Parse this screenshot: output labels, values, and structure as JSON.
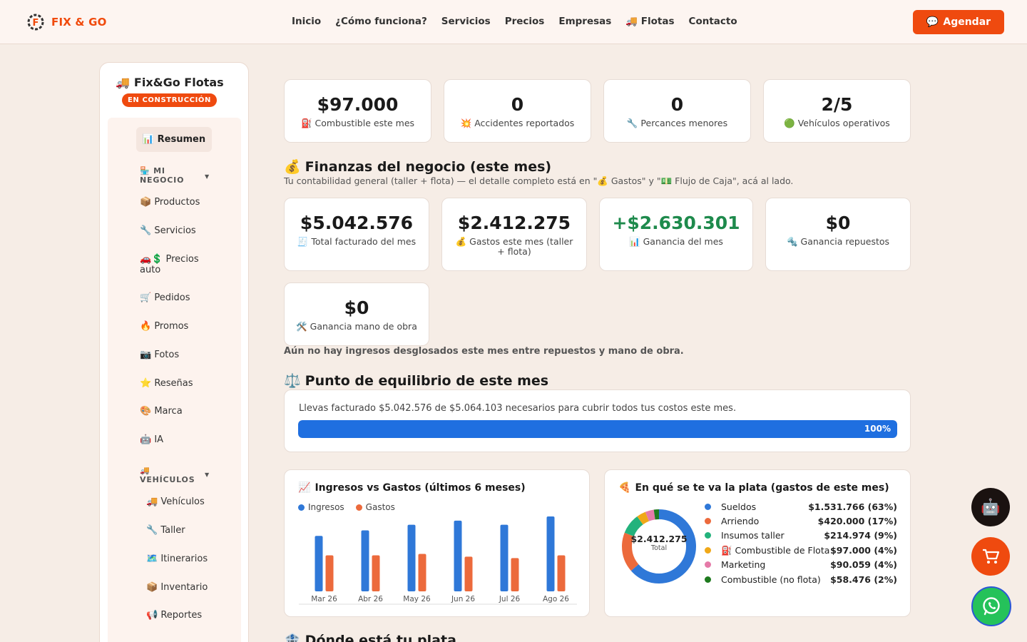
{
  "header": {
    "logo_text": "FIX & GO",
    "nav": [
      "Inicio",
      "¿Cómo funciona?",
      "Servicios",
      "Precios",
      "Empresas",
      "🚚 Flotas",
      "Contacto"
    ],
    "cta_label": "Agendar",
    "cta_icon": "💬"
  },
  "sidebar": {
    "title": "Fix&Go Flotas",
    "title_icon": "🚚",
    "badge": "EN CONSTRUCCIÓN",
    "active_item": "📊 Resumen",
    "section1": "🏪 MI NEGOCIO",
    "section1_items": [
      "📦 Productos",
      "🔧 Servicios",
      "🚗💲 Precios auto",
      "🛒 Pedidos",
      "🔥 Promos",
      "📷 Fotos",
      "⭐ Reseñas",
      "🎨 Marca",
      "🤖 IA"
    ],
    "section2": "🚚 VEHÍCULOS",
    "section2_items": [
      "🚚 Vehículos",
      "🔧 Taller",
      "🗺️ Itinerarios",
      "📦 Inventario",
      "📢 Reportes"
    ]
  },
  "stats": [
    {
      "value": "$97.000",
      "label": "⛽ Combustible este mes"
    },
    {
      "value": "0",
      "label": "💥 Accidentes reportados"
    },
    {
      "value": "0",
      "label": "🔧 Percances menores"
    },
    {
      "value": "2/5",
      "label": "🟢 Vehículos operativos"
    }
  ],
  "finance": {
    "heading": "Finanzas del negocio (este mes)",
    "heading_icon": "💰",
    "subtitle": "Tu contabilidad general (taller + flota) — el detalle completo está en \"💰 Gastos\" y \"💵 Flujo de Caja\", acá al lado.",
    "cards": [
      {
        "value": "$5.042.576",
        "label": "🧾 Total facturado del mes"
      },
      {
        "value": "$2.412.275",
        "label": "💰 Gastos este mes (taller + flota)"
      },
      {
        "value": "+$2.630.301",
        "label": "📊 Ganancia del mes"
      },
      {
        "value": "$0",
        "label": "🔩 Ganancia repuestos"
      },
      {
        "value": "$0",
        "label": "🛠️ Ganancia mano de obra"
      }
    ],
    "note": "Aún no hay ingresos desglosados este mes entre repuestos y mano de obra.",
    "positive_color": "#1e8a4c"
  },
  "breakeven": {
    "heading": "Punto de equilibrio de este mes",
    "heading_icon": "⚖️",
    "text": "Llevas facturado $5.042.576 de $5.064.103 necesarios para cubrir todos tus costos este mes.",
    "percent_label": "100%",
    "progress": 1.0
  },
  "income_chart": {
    "title": "Ingresos vs Gastos (últimos 6 meses)",
    "title_icon": "📈"
  },
  "expense_chart": {
    "title": "En qué se te va la plata (gastos de este mes)",
    "title_icon": "🍕",
    "total": "$2.412.275",
    "total_label": "Total",
    "rows": [
      {
        "name": "Sueldos",
        "value": "$1.531.766 (63%)"
      },
      {
        "name": "Arriendo",
        "value": "$420.000 (17%)"
      },
      {
        "name": "Insumos taller",
        "value": "$214.974 (9%)"
      },
      {
        "name": "⛽ Combustible de Flota",
        "value": "$97.000 (4%)"
      },
      {
        "name": "Marketing",
        "value": "$90.059 (4%)"
      },
      {
        "name": "Combustible (no flota)",
        "value": "$58.476 (2%)"
      }
    ]
  },
  "next_heading": "Dónde está tu plata",
  "next_heading_icon": "🏦",
  "chart_data": [
    {
      "type": "bar",
      "title": "Ingresos vs Gastos (últimos 6 meses)",
      "categories": [
        "Mar 26",
        "Abr 26",
        "May 26",
        "Jun 26",
        "Jul 26",
        "Ago 26"
      ],
      "series": [
        {
          "name": "Ingresos",
          "color": "#2f78d8",
          "values": [
            4.0,
            4.4,
            4.8,
            5.1,
            4.8,
            5.4
          ]
        },
        {
          "name": "Gastos",
          "color": "#ec6a3c",
          "values": [
            2.6,
            2.6,
            2.7,
            2.5,
            2.4,
            2.6
          ]
        }
      ],
      "legend": "top-left",
      "grid": false
    },
    {
      "type": "pie",
      "title": "En qué se te va la plata (gastos de este mes)",
      "labels": [
        "Sueldos",
        "Arriendo",
        "Insumos taller",
        "⛽ Combustible de Flota",
        "Marketing",
        "Combustible (no flota)"
      ],
      "values": [
        1531766,
        420000,
        214974,
        97000,
        90059,
        58476
      ],
      "colors": [
        "#2f78d8",
        "#ec6a3c",
        "#23b27c",
        "#f0a818",
        "#e57aa8",
        "#1e7a1e"
      ],
      "donut": true
    }
  ]
}
